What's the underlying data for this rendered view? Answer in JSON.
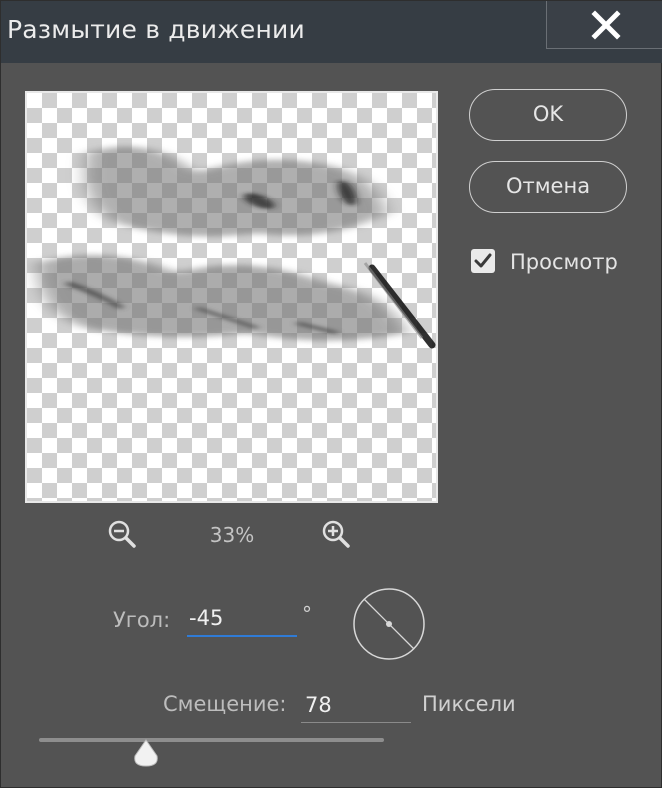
{
  "dialog": {
    "title": "Размытие в движении",
    "close_icon": "close-icon"
  },
  "buttons": {
    "ok_label": "OK",
    "cancel_label": "Отмена"
  },
  "preview_toggle": {
    "label": "Просмотр",
    "checked": true
  },
  "zoom": {
    "level": "33%",
    "zoom_out_icon": "zoom-out-icon",
    "zoom_in_icon": "zoom-in-icon"
  },
  "angle": {
    "label": "Угол:",
    "value": "-45",
    "unit": "°"
  },
  "distance": {
    "label": "Смещение:",
    "value": "78",
    "unit": "Пиксели",
    "slider_fraction": 0.31
  },
  "colors": {
    "dialog_bg": "#535353",
    "titlebar_bg": "#363d44",
    "focus_accent": "#2f7bd6"
  }
}
